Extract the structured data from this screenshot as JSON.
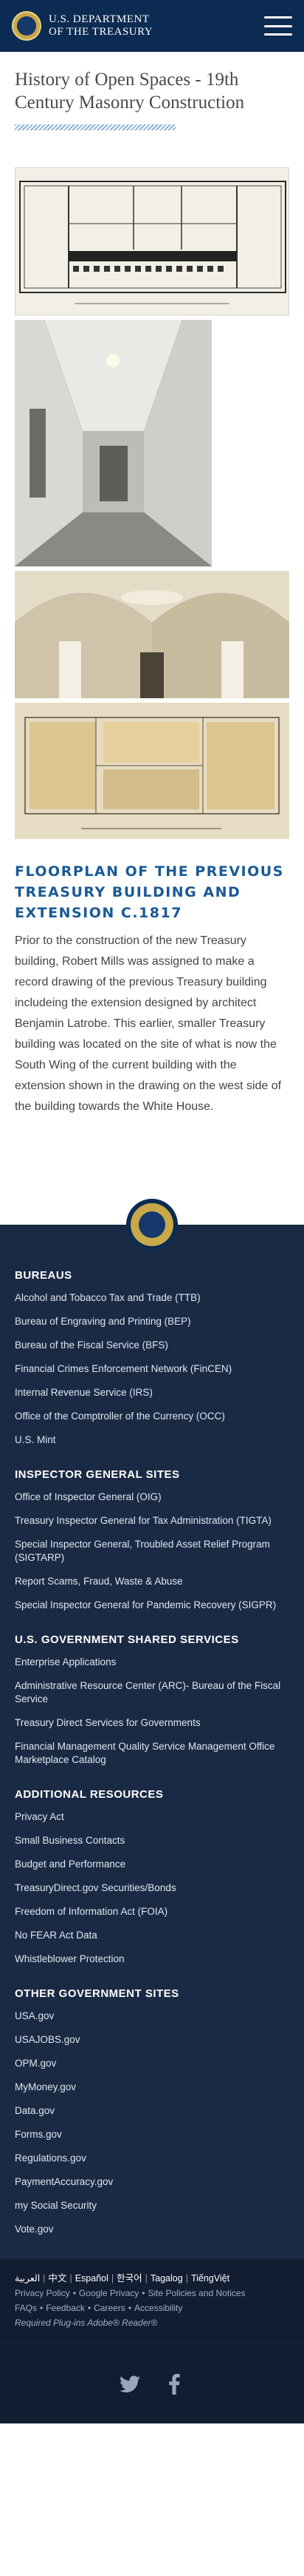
{
  "header": {
    "brand_line1": "U.S. DEPARTMENT",
    "brand_line2": "OF THE TREASURY"
  },
  "page": {
    "title": "History of Open Spaces - 19th Century Masonry Construction"
  },
  "article": {
    "heading": "FLOORPLAN OF THE PREVIOUS TREASURY BUILDING AND EXTENSION C.1817",
    "paragraph": "Prior to the construction of the new Treasury building, Robert Mills was assigned to make a record drawing of the previous Treasury building includeing the extension designed by architect Benjamin Latrobe. This earlier, smaller Treasury building was located on the site of what is now the South Wing of the current building with the extension shown in the drawing on the west side of the building towards the White House."
  },
  "footer": {
    "sections": [
      {
        "title": "BUREAUS",
        "links": [
          "Alcohol and Tobacco Tax and Trade (TTB)",
          "Bureau of Engraving and Printing (BEP)",
          "Bureau of the Fiscal Service (BFS)",
          "Financial Crimes Enforcement Network (FinCEN)",
          "Internal Revenue Service (IRS)",
          "Office of the Comptroller of the Currency (OCC)",
          "U.S. Mint"
        ]
      },
      {
        "title": "INSPECTOR GENERAL SITES",
        "links": [
          "Office of Inspector General (OIG)",
          "Treasury Inspector General for Tax Administration (TIGTA)",
          "Special Inspector General, Troubled Asset Relief Program (SIGTARP)",
          "Report Scams, Fraud, Waste & Abuse",
          "Special Inspector General for Pandemic Recovery (SIGPR)"
        ]
      },
      {
        "title": "U.S. GOVERNMENT SHARED SERVICES",
        "links": [
          "Enterprise Applications",
          "Administrative Resource Center (ARC)- Bureau of the Fiscal Service",
          "Treasury Direct Services for Governments",
          "Financial Management Quality Service Management Office Marketplace Catalog"
        ]
      },
      {
        "title": "ADDITIONAL RESOURCES",
        "links": [
          "Privacy Act",
          "Small Business Contacts",
          "Budget and Performance",
          "TreasuryDirect.gov Securities/Bonds",
          "Freedom of Information Act (FOIA)",
          "No FEAR Act Data",
          "Whistleblower Protection"
        ]
      },
      {
        "title": "OTHER GOVERNMENT SITES",
        "links": [
          "USA.gov",
          "USAJOBS.gov",
          "OPM.gov",
          "MyMoney.gov",
          "Data.gov",
          "Forms.gov",
          "Regulations.gov",
          "PaymentAccuracy.gov",
          "my Social Security",
          "Vote.gov"
        ]
      }
    ],
    "languages": [
      "العربية",
      "中文",
      "Español",
      "한국어",
      "Tagalog",
      "TiếngViệt"
    ],
    "meta_links": [
      "Privacy Policy",
      "Google Privacy",
      "Site Policies and Notices",
      "FAQs",
      "Feedback",
      "Careers",
      "Accessibility"
    ],
    "plugins_label": "Required Plug-ins",
    "plugins_value": "Adobe® Reader®"
  },
  "icons": {
    "menu": "hamburger-menu-icon",
    "twitter": "twitter-icon",
    "facebook": "facebook-icon"
  },
  "colors": {
    "header_bg": "#0c2b52",
    "heading_blue": "#1a5a96",
    "footer_bg": "#1b2a44",
    "footer_bottom_bg": "#121d31"
  }
}
